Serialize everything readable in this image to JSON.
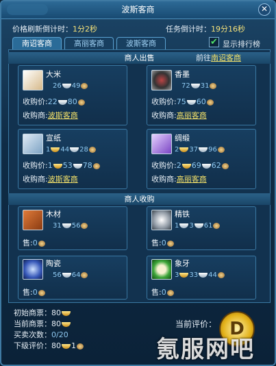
{
  "window": {
    "title": "波斯客商",
    "close_glyph": "✕"
  },
  "timers": {
    "price_label": "价格刷新倒计时：",
    "price_value": "1分2秒",
    "task_label": "任务倒计时：",
    "task_value": "19分16秒"
  },
  "tabs": [
    "南诏客商",
    "高丽客商",
    "波斯客商"
  ],
  "rank_toggle": {
    "label": "显示排行榜",
    "checked": true,
    "glyph": "✔"
  },
  "sell_section": {
    "title": "商人出售",
    "goto_prefix": "前往",
    "goto_link": "南诏客商"
  },
  "labels": {
    "buy_price": "收购价:",
    "buyer": "收购商:",
    "sell": "售:"
  },
  "sell_items": [
    {
      "name": "大米",
      "icon": "rice-icon",
      "price": [
        "26",
        "49"
      ],
      "buy": [
        "22",
        "80"
      ],
      "merchant": "波斯客商"
    },
    {
      "name": "香墨",
      "icon": "ink-icon",
      "price": [
        "72",
        "31"
      ],
      "buy": [
        "75",
        "60"
      ],
      "merchant": "高丽客商"
    },
    {
      "name": "宣纸",
      "icon": "paper-icon",
      "price": [
        "1",
        "44",
        "28"
      ],
      "buy": [
        "1",
        "53",
        "78"
      ],
      "merchant": "波斯客商"
    },
    {
      "name": "绸缎",
      "icon": "silk-icon",
      "price": [
        "2",
        "37",
        "96"
      ],
      "buy": [
        "2",
        "69",
        "62"
      ],
      "merchant": "高丽客商"
    }
  ],
  "buy_section": {
    "title": "商人收购"
  },
  "buy_items": [
    {
      "name": "木材",
      "icon": "wood-icon",
      "price": [
        "31",
        "56"
      ],
      "sell": "0"
    },
    {
      "name": "精铁",
      "icon": "iron-icon",
      "price": [
        "1",
        "3",
        "61"
      ],
      "sell": "0"
    },
    {
      "name": "陶瓷",
      "icon": "porcelain-icon",
      "price": [
        "56",
        "64"
      ],
      "sell": "0"
    },
    {
      "name": "象牙",
      "icon": "ivory-icon",
      "price": [
        "3",
        "33",
        "44"
      ],
      "sell": "0"
    }
  ],
  "stats": {
    "initial_label": "初始商票：",
    "initial_value": "80",
    "current_label": "当前商票：",
    "current_value": "80",
    "trades_label": "买卖次数：",
    "trades_value": "0/20",
    "next_label": "下级评价：",
    "next_value": "80",
    "next_extra": "1"
  },
  "evaluation": {
    "label": "当前评价：",
    "grade": "D"
  },
  "watermark": "氪服网吧",
  "colors": {
    "accent": "#f3e16a",
    "link": "#f3e16a",
    "price": "#8fc9f1"
  }
}
